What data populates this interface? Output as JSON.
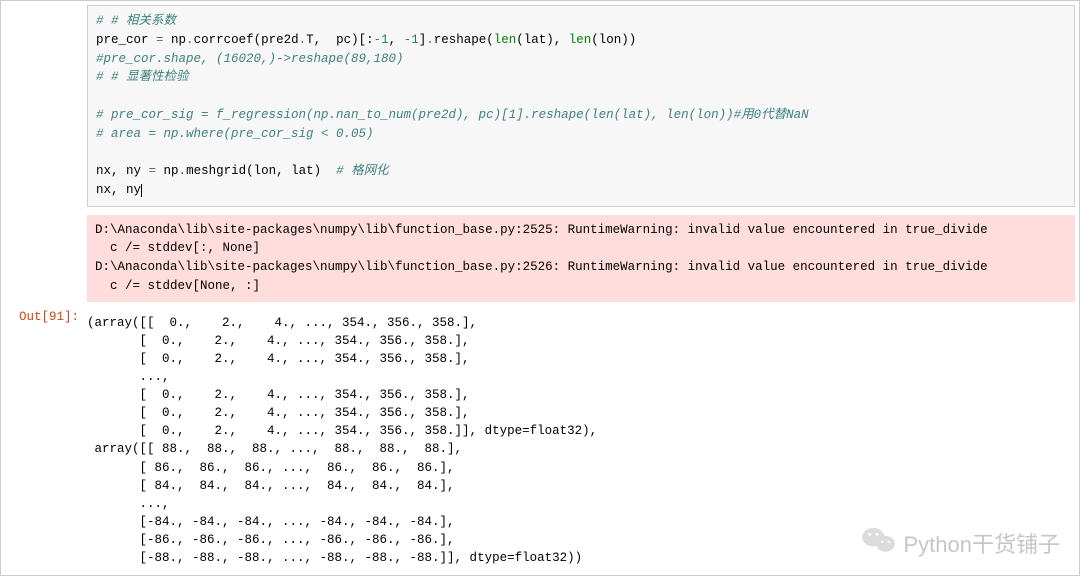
{
  "code": {
    "line0": "# # 相关系数",
    "line1_a": "pre_cor ",
    "line1_op": "=",
    "line1_b": " np",
    "line1_dot": ".",
    "line1_c": "corrcoef(pre2d",
    "line1_dot2": ".",
    "line1_T": "T,  pc)[:",
    "line1_neg1": "-",
    "line1_one": "1",
    "line1_comma": ", ",
    "line1_neg2": "-",
    "line1_one2": "1",
    "line1_r": "]",
    "line1_dot3": ".",
    "line1_reshape": "reshape(",
    "line1_len": "len",
    "line1_parlat": "(lat), ",
    "line1_len2": "len",
    "line1_parlon": "(lon))",
    "line2": "#pre_cor.shape, (16020,)->reshape(89,180)",
    "line3": "# # 显著性检验",
    "line4": "",
    "line5": "# pre_cor_sig = f_regression(np.nan_to_num(pre2d), pc)[1].reshape(len(lat), len(lon))#用0代替NaN",
    "line6": "# area = np.where(pre_cor_sig < 0.05)",
    "line7": "",
    "line8_a": "nx, ny ",
    "line8_op": "=",
    "line8_b": " np",
    "line8_dot": ".",
    "line8_c": "meshgrid(lon, lat)  ",
    "line8_comment": "# 格网化",
    "line9": "nx, ny"
  },
  "warning": {
    "l1": "D:\\Anaconda\\lib\\site-packages\\numpy\\lib\\function_base.py:2525: RuntimeWarning: invalid value encountered in true_divide",
    "l2": "  c /= stddev[:, None]",
    "l3": "D:\\Anaconda\\lib\\site-packages\\numpy\\lib\\function_base.py:2526: RuntimeWarning: invalid value encountered in true_divide",
    "l4": "  c /= stddev[None, :]"
  },
  "output": {
    "prompt": "Out[91]:",
    "l01": "(array([[  0.,    2.,    4., ..., 354., 356., 358.],",
    "l02": "       [  0.,    2.,    4., ..., 354., 356., 358.],",
    "l03": "       [  0.,    2.,    4., ..., 354., 356., 358.],",
    "l04": "       ...,",
    "l05": "       [  0.,    2.,    4., ..., 354., 356., 358.],",
    "l06": "       [  0.,    2.,    4., ..., 354., 356., 358.],",
    "l07": "       [  0.,    2.,    4., ..., 354., 356., 358.]], dtype=float32),",
    "l08": " array([[ 88.,  88.,  88., ...,  88.,  88.,  88.],",
    "l09": "       [ 86.,  86.,  86., ...,  86.,  86.,  86.],",
    "l10": "       [ 84.,  84.,  84., ...,  84.,  84.,  84.],",
    "l11": "       ...,",
    "l12": "       [-84., -84., -84., ..., -84., -84., -84.],",
    "l13": "       [-86., -86., -86., ..., -86., -86., -86.],",
    "l14": "       [-88., -88., -88., ..., -88., -88., -88.]], dtype=float32))"
  },
  "watermark": {
    "text": "Python干货铺子"
  }
}
